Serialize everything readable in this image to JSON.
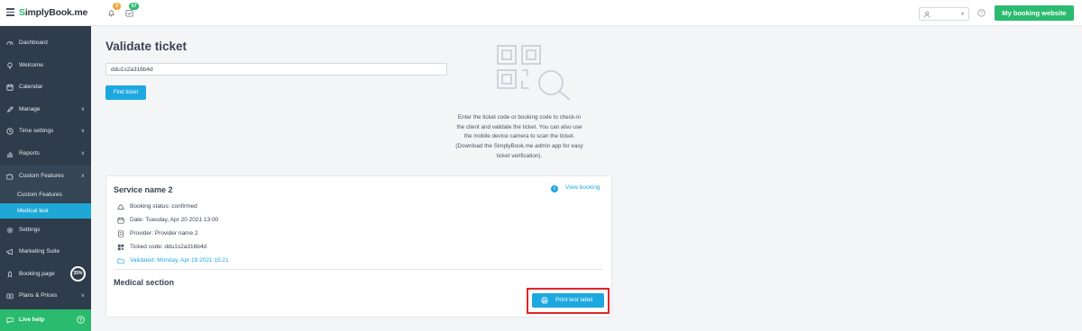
{
  "topbar": {
    "logo_prefix": "S",
    "logo_rest": "implyBook.me",
    "notifications_count": "3",
    "tasks_count": "57",
    "my_booking_label": "My booking website"
  },
  "sidebar": {
    "items": [
      {
        "label": "Dashboard",
        "icon": "dashboard-icon"
      },
      {
        "label": "Welcome",
        "icon": "lightbulb-icon"
      },
      {
        "label": "Calendar",
        "icon": "calendar-icon"
      },
      {
        "label": "Manage",
        "icon": "pencil-icon",
        "chevron": "∨"
      },
      {
        "label": "Time settings",
        "icon": "clock-icon",
        "chevron": "∨"
      },
      {
        "label": "Reports",
        "icon": "chart-icon",
        "chevron": "∨"
      },
      {
        "label": "Custom Features",
        "icon": "puzzle-icon",
        "chevron": "∧"
      },
      {
        "label": "Settings",
        "icon": "gear-icon"
      },
      {
        "label": "Marketing Suite",
        "icon": "megaphone-icon"
      },
      {
        "label": "Booking.page",
        "icon": "rocket-icon"
      },
      {
        "label": "Plans & Prices",
        "icon": "wallet-icon",
        "chevron": "∨"
      }
    ],
    "sub_items": [
      {
        "label": "Custom Features"
      },
      {
        "label": "Medical test"
      }
    ],
    "booking_page_progress": "35%",
    "live_help_label": "Live help"
  },
  "main": {
    "title": "Validate ticket",
    "ticket_code_value": "ddu1s2a316b4d",
    "find_button_label": "Find ticket",
    "hint_lines": [
      "Enter the ticket code or booking code to check-in",
      "the client and validate the ticket. You can also use",
      "the mobile device camera to scan the ticket.",
      "(Download the SimplyBook.me admin app for easy",
      "ticket verification)."
    ],
    "card": {
      "service_title": "Service name 2",
      "view_booking_label": "View booking",
      "details": [
        {
          "text": "Booking status: confirmed",
          "icon": "cloud-icon"
        },
        {
          "text": "Date: Tuesday, Apr 20 2021 13:00",
          "icon": "calendar-icon"
        },
        {
          "text": "Provider: Provider name 2",
          "icon": "id-card-icon"
        },
        {
          "text": "Ticked code: ddu1s2a316b4d",
          "icon": "qr-code-icon"
        },
        {
          "text": "Validated: Monday, Apr 19 2021 15:21",
          "icon": "folder-icon"
        }
      ],
      "medical_section_title": "Medical section",
      "print_button_label": "Print test label"
    }
  },
  "colors": {
    "brand_green": "#2bbb6e",
    "accent_blue": "#1ea8e0",
    "sidebar_bg": "#2e3c4b",
    "highlight_red": "#e3242b"
  }
}
